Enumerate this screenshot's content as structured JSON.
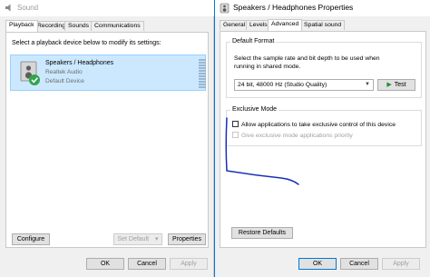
{
  "sound_window": {
    "title": "Sound",
    "tabs": [
      {
        "label": "Playback",
        "active": true
      },
      {
        "label": "Recording",
        "active": false
      },
      {
        "label": "Sounds",
        "active": false
      },
      {
        "label": "Communications",
        "active": false
      }
    ],
    "instruction": "Select a playback device below to modify its settings:",
    "device": {
      "name": "Speakers / Headphones",
      "driver": "Realtek Audio",
      "status": "Default Device",
      "icon": "speaker-icon",
      "badge_icon": "check-badge-icon"
    },
    "buttons": {
      "configure": "Configure",
      "set_default": "Set Default",
      "set_default_arrow": "▾",
      "properties": "Properties",
      "ok": "OK",
      "cancel": "Cancel",
      "apply": "Apply"
    }
  },
  "props_window": {
    "title": "Speakers / Headphones Properties",
    "tabs": [
      {
        "label": "General",
        "active": false
      },
      {
        "label": "Levels",
        "active": false
      },
      {
        "label": "Advanced",
        "active": true
      },
      {
        "label": "Spatial sound",
        "active": false
      }
    ],
    "default_format": {
      "group_label": "Default Format",
      "description": "Select the sample rate and bit depth to be used when running in shared mode.",
      "selected_format": "24 bit, 48000 Hz (Studio Quality)",
      "test_label": "Test"
    },
    "exclusive_mode": {
      "group_label": "Exclusive Mode",
      "allow_label": "Allow applications to take exclusive control of this device",
      "allow_checked": false,
      "priority_label": "Give exclusive mode applications priority",
      "priority_checked": false,
      "priority_enabled": false
    },
    "buttons": {
      "restore_defaults": "Restore Defaults",
      "ok": "OK",
      "cancel": "Cancel",
      "apply": "Apply"
    }
  },
  "colors": {
    "accent": "#0078d7",
    "selection": "#cce8ff",
    "annotation_ink": "#1a2fb8",
    "play_green": "#1e8f2f"
  }
}
